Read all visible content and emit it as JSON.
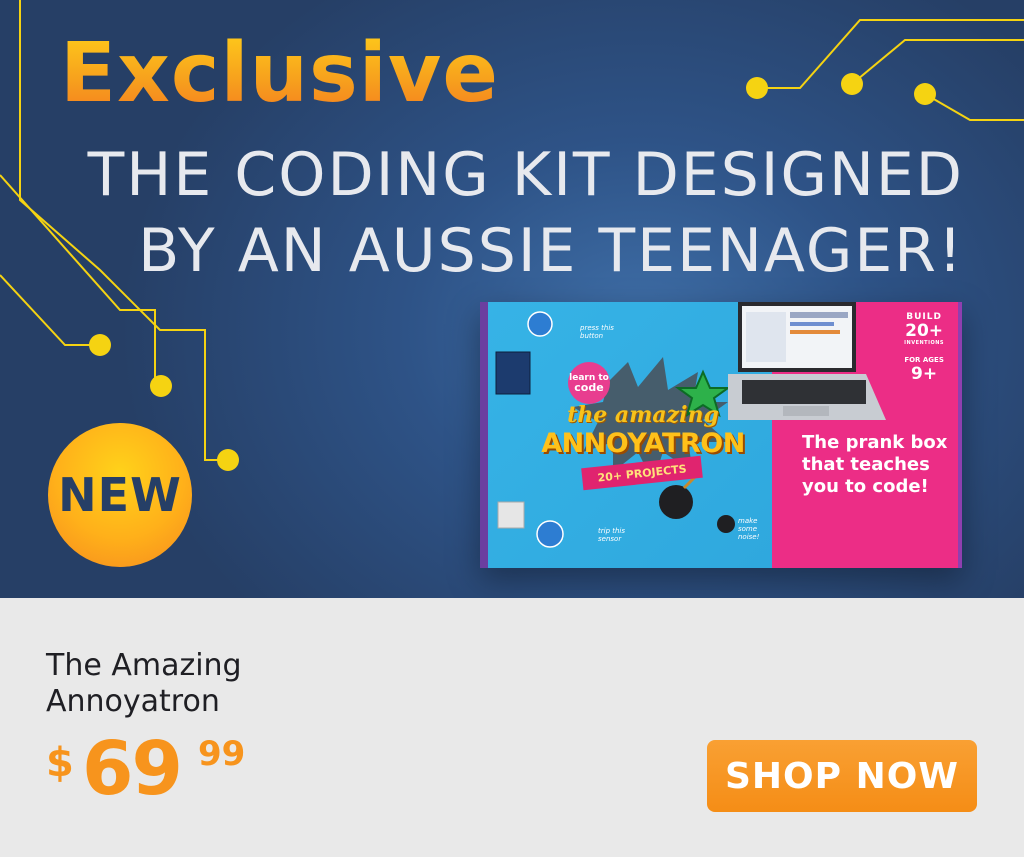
{
  "headline": {
    "exclusive": "Exclusive",
    "line1": "THE CODING KIT DESIGNED",
    "line2": "BY AN AUSSIE TEENAGER!"
  },
  "badge": {
    "label": "NEW"
  },
  "box": {
    "build_label": "BUILD",
    "build_count": "20+",
    "inventions_label": "INVENTIONS",
    "ages_label": "FOR AGES",
    "ages_value": "9+",
    "tagline": "The prank box that teaches you to code!",
    "title_small": "the amazing",
    "title_big": "ANNOYATRON",
    "ribbon": "20+ PROJECTS",
    "learn_line1": "learn to",
    "learn_line2": "code",
    "note_press": "press this button",
    "note_trip": "trip this sensor",
    "note_noise": "make some noise!"
  },
  "product": {
    "name_line1": "The Amazing",
    "name_line2": "Annoyatron",
    "price_currency": "$",
    "price_dollars": "69",
    "price_cents": "99"
  },
  "cta": {
    "label": "SHOP NOW"
  },
  "colors": {
    "banner_bg": "#2e5387",
    "accent_orange": "#f7941d",
    "circuit_yellow": "#f5d312",
    "box_blue": "#36b3e6",
    "box_pink": "#ec2d86"
  }
}
